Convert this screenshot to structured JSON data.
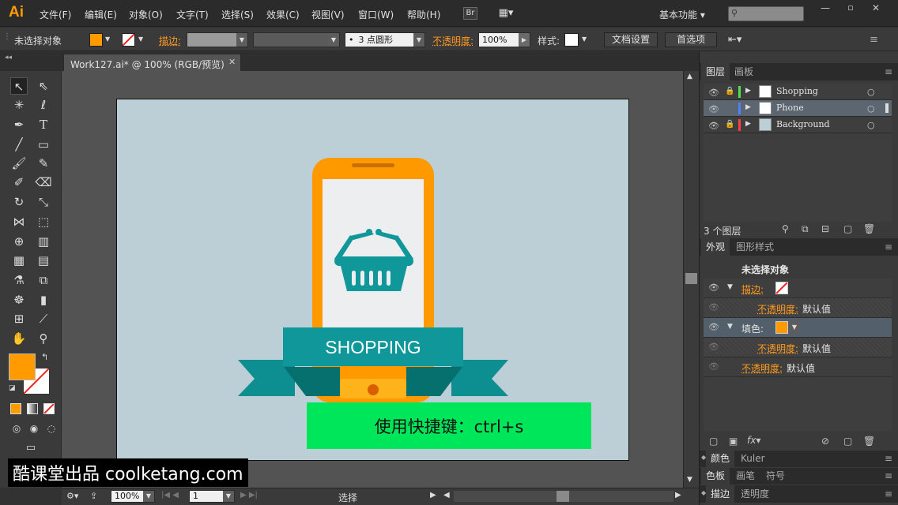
{
  "app": {
    "logo": "Ai",
    "colors": {
      "accent": "#ff9a00",
      "teal": "#10979a",
      "phone_orange": "#fe9900",
      "green_banner": "#00e65b"
    }
  },
  "menubar": {
    "items": [
      "文件(F)",
      "编辑(E)",
      "对象(O)",
      "文字(T)",
      "选择(S)",
      "效果(C)",
      "视图(V)",
      "窗口(W)",
      "帮助(H)"
    ],
    "bridge_label": "Br",
    "workspace": "基本功能"
  },
  "control": {
    "no_selection": "未选择对象",
    "stroke_label": "描边:",
    "brush_label": "3 点圆形",
    "opacity_label": "不透明度:",
    "opacity_value": "100%",
    "style_label": "样式:",
    "doc_setup": "文档设置",
    "prefs": "首选项"
  },
  "document": {
    "tab_title": "Work127.ai* @ 100% (RGB/预览)"
  },
  "artwork": {
    "banner_text": "SHOPPING",
    "shortcut_text": "使用快捷键：ctrl+s"
  },
  "status": {
    "zoom": "100%",
    "page": "1",
    "tool": "选择"
  },
  "layers_panel": {
    "tabs": [
      "图层",
      "画板"
    ],
    "layers": [
      {
        "name": "Shopping",
        "color": "#4de14d"
      },
      {
        "name": "Phone",
        "color": "#4e7fff"
      },
      {
        "name": "Background",
        "color": "#ff4040"
      }
    ],
    "count_label": "3 个图层"
  },
  "appearance_panel": {
    "tabs": [
      "外观",
      "图形样式"
    ],
    "title": "未选择对象",
    "stroke_label": "描边:",
    "opacity_label": "不透明度:",
    "default_value": "默认值",
    "fill_label": "填色:"
  },
  "lower_panels": {
    "color_tabs": [
      "颜色",
      "Kuler"
    ],
    "swatch_tabs": [
      "色板",
      "画笔",
      "符号"
    ],
    "stroke_tabs": [
      "描边",
      "透明度"
    ]
  },
  "watermark": "酷课堂出品 coolketang.com"
}
